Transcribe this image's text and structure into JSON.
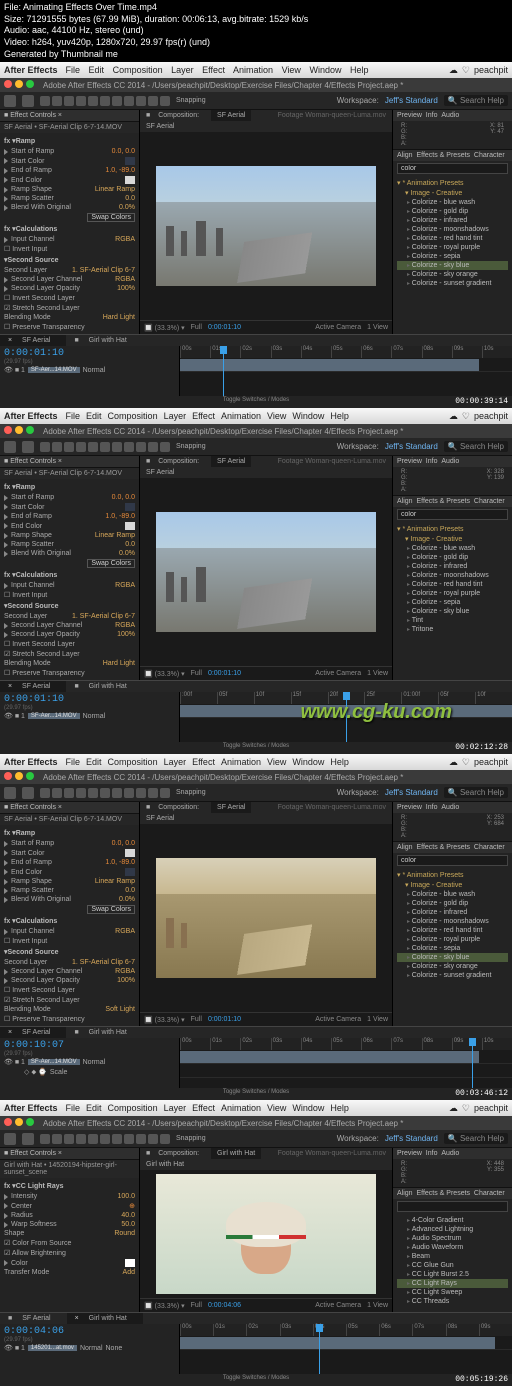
{
  "meta": {
    "file": "File: Animating Effects Over Time.mp4",
    "size": "Size: 71291555 bytes (67.99 MiB), duration: 00:06:13, avg.bitrate: 1529 kb/s",
    "audio": "Audio: aac, 44100 Hz, stereo (und)",
    "video": "Video: h264, yuv420p, 1280x720, 29.97 fps(r) (und)",
    "gen": "Generated by Thumbnail me"
  },
  "menubar": {
    "app": "After Effects",
    "items": [
      "File",
      "Edit",
      "Composition",
      "Layer",
      "Effect",
      "Animation",
      "View",
      "Window",
      "Help"
    ],
    "user": "peachpit"
  },
  "titlebar": "Adobe After Effects CC 2014 - /Users/peachpit/Desktop/Exercise Files/Chapter 4/Effects Project.aep *",
  "toolbar": {
    "snapping": "Snapping",
    "workspace_lbl": "Workspace:",
    "workspace": "Jeff's Standard",
    "search": "Search Help"
  },
  "effect_controls": {
    "tab": "Effect Controls",
    "layer_a": "SF Aerial • SF-Aerial Clip 6-7-14.MOV",
    "layer_b": "Girl with Hat • 14520194-hipster-girl-sunset_scene",
    "ramp": "Ramp",
    "props": [
      {
        "name": "Start of Ramp",
        "val": "0.0, 0.0"
      },
      {
        "name": "Start Color",
        "swatch": "#303848"
      },
      {
        "name": "End of Ramp",
        "val": "1.0, -89.0"
      },
      {
        "name": "End Color",
        "swatch": "#d8d8d8"
      },
      {
        "name": "Ramp Shape",
        "val": "Linear Ramp"
      },
      {
        "name": "Ramp Scatter",
        "val": "0.0"
      },
      {
        "name": "Blend With Original",
        "val": "0.0%"
      }
    ],
    "swap": "Swap Colors",
    "calc": "Calculations",
    "input_ch": "Input Channel",
    "rgba": "RGBA",
    "invert": "Invert Input",
    "second_src": "Second Source",
    "second_layer": "Second Layer",
    "second_layer_val": "1. SF-Aerial Clip 6-7",
    "second_ch": "Second Layer Channel",
    "second_op": "Second Layer Opacity",
    "op100": "100%",
    "invert2": "Invert Second Layer",
    "stretch": "Stretch Second Layer",
    "blend_mode": "Blending Mode",
    "hard_light": "Hard Light",
    "soft_light": "Soft Light",
    "preserve": "Preserve Transparency",
    "cc_light": "CC Light Rays",
    "cc_props": [
      {
        "name": "Intensity",
        "val": "100.0"
      },
      {
        "name": "Center",
        "val": ""
      },
      {
        "name": "Radius",
        "val": "40.0"
      },
      {
        "name": "Warp Softness",
        "val": "50.0"
      },
      {
        "name": "Shape",
        "val": "Round"
      },
      {
        "name": " ",
        "val": "Color From Source"
      },
      {
        "name": " ",
        "val": "Allow Brightening"
      },
      {
        "name": "Color",
        "swatch": "#ffffff"
      },
      {
        "name": "Transfer Mode",
        "val": "Add"
      }
    ]
  },
  "comp": {
    "tab_a": "Composition:",
    "name_aerial": "SF Aerial",
    "name_girl": "Girl with Hat",
    "footage": "Footage Woman-queen-Luma.mov",
    "zoom": "(33.3%)",
    "tc": "0:00:01:10",
    "full": "Full",
    "cam": "Active Camera",
    "view": "1 View"
  },
  "right": {
    "preview": "Preview",
    "info": "Info",
    "audio": "Audio",
    "r": "R:",
    "g": "G:",
    "b": "B:",
    "a": "A:",
    "x": "X:",
    "y": "Y:",
    "xv1": "81",
    "yv1": "47",
    "xv2": "328",
    "yv2": "139",
    "xv4": "448",
    "yv4": "355",
    "align": "Align",
    "ep": "Effects & Presets",
    "char": "Character",
    "search": "color",
    "search_blank": "",
    "ap": "* Animation Presets",
    "folder": "Image - Creative",
    "items_a": [
      "Colorize - blue wash",
      "Colorize - gold dip",
      "Colorize - infrared",
      "Colorize - moonshadows",
      "Colorize - red hand tint",
      "Colorize - royal purple",
      "Colorize - sepia",
      "Colorize - sky blue",
      "Colorize - sky orange",
      "Colorize - sunset gradient"
    ],
    "items_b": [
      "Colorize - blue wash",
      "Colorize - gold dip",
      "Colorize - infrared",
      "Colorize - moonshadows",
      "Colorize - red hand tint",
      "Colorize - royal purple",
      "Colorize - sepia",
      "Colorize - sky blue",
      "Tint",
      "Tritone"
    ],
    "items_d": [
      "4-Color Gradient",
      "Advanced Lightning",
      "Audio Spectrum",
      "Audio Waveform",
      "Beam",
      "CC Glue Gun",
      "CC Light Burst 2.5",
      "CC Light Rays",
      "CC Light Sweep",
      "CC Threads"
    ],
    "hl_a": "Colorize - sky blue",
    "hl_d": "CC Light Rays"
  },
  "timeline": {
    "tab_aerial": "SF Aerial",
    "tab_girl": "Girl with Hat",
    "tc1": "0:00:01:10",
    "tc3": "0:00:10:07",
    "tc4": "0:00:04:06",
    "fps": "(29.97 fps)",
    "layer1": "SF-Aer...14.MOV",
    "layer4": "145201...at.mov",
    "scale": "Scale",
    "normal": "Normal",
    "none": "None",
    "marks": [
      "00s",
      "01s",
      "02s",
      "03s",
      "04s",
      "05s",
      "06s",
      "07s",
      "08s",
      "09s",
      "10s"
    ],
    "marks2": [
      ":00f",
      "05f",
      "10f",
      "15f",
      "20f",
      "25f",
      "01:00f",
      "05f",
      "10f"
    ],
    "foot": "Toggle Switches / Modes"
  },
  "corners": {
    "t1": "00:00:39:14",
    "t2": "00:02:12:28",
    "t3": "00:03:46:12",
    "t4": "00:05:19:26"
  },
  "watermark": "www.cg-ku.com"
}
